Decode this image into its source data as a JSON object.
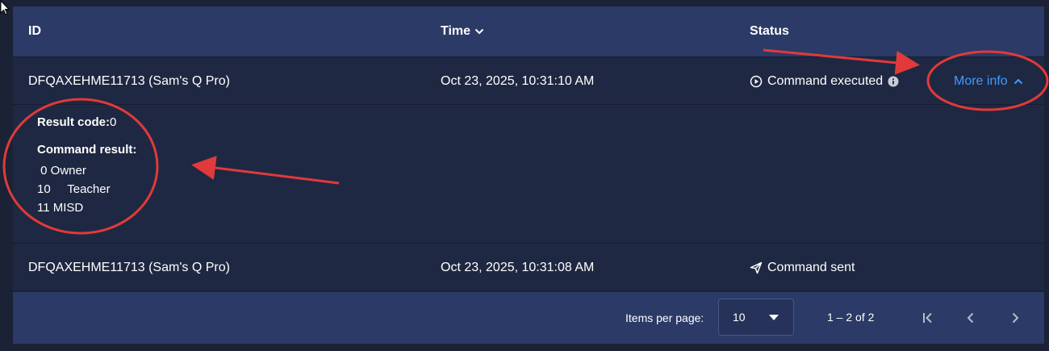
{
  "table": {
    "columns": {
      "id": "ID",
      "time": "Time",
      "status": "Status"
    },
    "rows": [
      {
        "id": "DFQAXEHME11713 (Sam's Q Pro)",
        "time": "Oct 23, 2025, 10:31:10 AM",
        "status": "Command executed",
        "action": "More info"
      },
      {
        "id": "DFQAXEHME11713 (Sam's Q Pro)",
        "time": "Oct 23, 2025, 10:31:08 AM",
        "status": "Command sent"
      }
    ],
    "expanded": {
      "result_code_label": "Result code:",
      "result_code_value": "0",
      "command_result_label": "Command result:",
      "command_result_lines": [
        " 0 Owner",
        "10     Teacher",
        "11 MISD"
      ]
    }
  },
  "pagination": {
    "items_per_page_label": "Items per page:",
    "items_per_page_value": "10",
    "range": "1 – 2 of 2"
  },
  "colors": {
    "header_bg": "#2b3a66",
    "row_bg": "#1f2842",
    "link": "#3f9bff",
    "annotation": "#e03a3a"
  },
  "icons": {
    "sort": "chevron-down-icon",
    "executed": "play-circle-icon",
    "info": "info-icon",
    "sent": "paper-plane-icon",
    "collapse": "chevron-up-icon",
    "first_page": "first-page-icon",
    "prev_page": "chevron-left-icon",
    "next_page": "chevron-right-icon"
  }
}
